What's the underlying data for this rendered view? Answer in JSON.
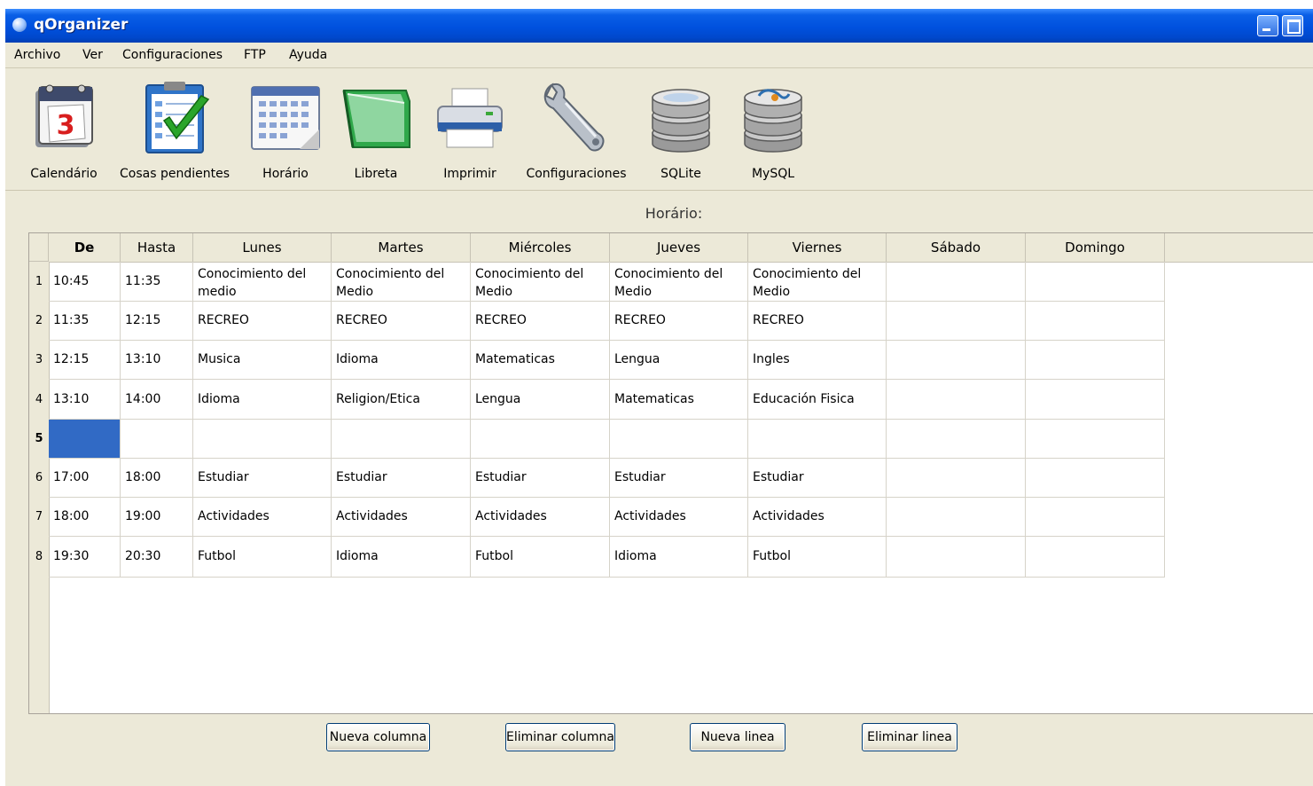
{
  "window": {
    "title": "qOrganizer",
    "colors": {
      "title_bar": "#0051de",
      "window_bg": "#ece9d8",
      "selection": "#316ac5"
    }
  },
  "menu": [
    "Archivo",
    "Ver",
    "Configuraciones",
    "FTP",
    "Ayuda"
  ],
  "toolbar": [
    {
      "label": "Calendário",
      "icon": "calendar-icon"
    },
    {
      "label": "Cosas pendientes",
      "icon": "todo-checklist-icon"
    },
    {
      "label": "Horário",
      "icon": "timetable-icon"
    },
    {
      "label": "Libreta",
      "icon": "notebook-icon"
    },
    {
      "label": "Imprimir",
      "icon": "printer-icon"
    },
    {
      "label": "Configuraciones",
      "icon": "wrench-icon"
    },
    {
      "label": "SQLite",
      "icon": "sqlite-database-icon"
    },
    {
      "label": "MySQL",
      "icon": "mysql-database-icon"
    }
  ],
  "timetable": {
    "title": "Horário:",
    "columns": [
      "De",
      "Hasta",
      "Lunes",
      "Martes",
      "Miércoles",
      "Jueves",
      "Viernes",
      "Sábado",
      "Domingo"
    ],
    "rows": [
      {
        "num": "1",
        "cells": [
          "10:45",
          "11:35",
          "Conocimiento del medio",
          "Conocimiento del Medio",
          "Conocimiento del Medio",
          "Conocimiento del Medio",
          "Conocimiento del Medio",
          "",
          ""
        ]
      },
      {
        "num": "2",
        "cells": [
          "11:35",
          "12:15",
          "RECREO",
          "RECREO",
          "RECREO",
          "RECREO",
          "RECREO",
          "",
          ""
        ]
      },
      {
        "num": "3",
        "cells": [
          "12:15",
          "13:10",
          "Musica",
          "Idioma",
          "Matematicas",
          "Lengua",
          "Ingles",
          "",
          ""
        ]
      },
      {
        "num": "4",
        "cells": [
          "13:10",
          "14:00",
          "Idioma",
          "Religion/Etica",
          "Lengua",
          "Matematicas",
          "Educación Fisica",
          "",
          ""
        ]
      },
      {
        "num": "5",
        "cells": [
          "",
          "",
          "",
          "",
          "",
          "",
          "",
          "",
          ""
        ]
      },
      {
        "num": "6",
        "cells": [
          "17:00",
          "18:00",
          "Estudiar",
          "Estudiar",
          "Estudiar",
          "Estudiar",
          "Estudiar",
          "",
          ""
        ]
      },
      {
        "num": "7",
        "cells": [
          "18:00",
          "19:00",
          "Actividades",
          "Actividades",
          "Actividades",
          "Actividades",
          "Actividades",
          "",
          ""
        ]
      },
      {
        "num": "8",
        "cells": [
          "19:30",
          "20:30",
          "Futbol",
          "Idioma",
          "Futbol",
          "Idioma",
          "Futbol",
          "",
          ""
        ]
      }
    ]
  },
  "buttons": {
    "new_column": "Nueva columna",
    "delete_column": "Eliminar columna",
    "new_row": "Nueva linea",
    "delete_row": "Eliminar linea"
  }
}
